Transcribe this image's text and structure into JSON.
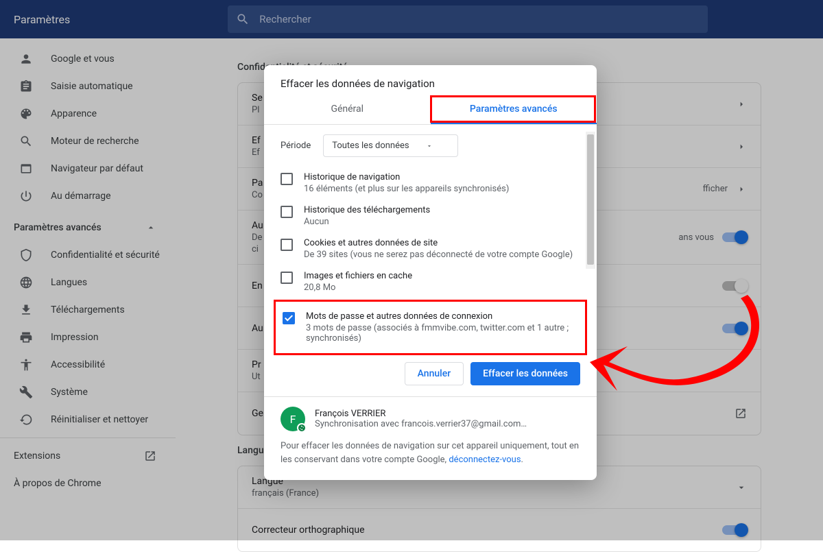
{
  "header": {
    "title": "Paramètres",
    "search_placeholder": "Rechercher"
  },
  "sidebar": {
    "items": [
      {
        "label": "Google et vous"
      },
      {
        "label": "Saisie automatique"
      },
      {
        "label": "Apparence"
      },
      {
        "label": "Moteur de recherche"
      },
      {
        "label": "Navigateur par défaut"
      },
      {
        "label": "Au démarrage"
      }
    ],
    "advanced_label": "Paramètres avancés",
    "advanced_items": [
      {
        "label": "Confidentialité et sécurité"
      },
      {
        "label": "Langues"
      },
      {
        "label": "Téléchargements"
      },
      {
        "label": "Impression"
      },
      {
        "label": "Accessibilité"
      },
      {
        "label": "Système"
      },
      {
        "label": "Réinitialiser et nettoyer"
      }
    ],
    "extensions": "Extensions",
    "about": "À propos de Chrome"
  },
  "main": {
    "section1_title": "Confidentialité et sécurité",
    "rows": [
      {
        "title": "Se",
        "sub": "Pl"
      },
      {
        "title": "Ef",
        "sub": "Ef"
      },
      {
        "title": "Pa",
        "sub": "Co",
        "right": "fficher"
      },
      {
        "title": "Au",
        "sub": "De",
        "right": "ans vous",
        "toggle": "on",
        "sub2": "ci"
      },
      {
        "title": "En",
        "sub": "",
        "toggle": "off"
      },
      {
        "title": "Au",
        "sub": "",
        "toggle": "on"
      },
      {
        "title": "Pr",
        "sub": "Ut"
      },
      {
        "title": "Ge",
        "sub": ""
      }
    ],
    "section2_title": "Langues",
    "lang_row": {
      "title": "Langue",
      "sub": "français (France)"
    },
    "spell_row": {
      "title": "Correcteur orthographique"
    }
  },
  "modal": {
    "title": "Effacer les données de navigation",
    "tab_general": "Général",
    "tab_advanced": "Paramètres avancés",
    "period_label": "Période",
    "period_value": "Toutes les données",
    "items": [
      {
        "t1": "Historique de navigation",
        "t2": "16 éléments (et plus sur les appareils synchronisés)",
        "checked": false
      },
      {
        "t1": "Historique des téléchargements",
        "t2": "Aucun",
        "checked": false
      },
      {
        "t1": "Cookies et autres données de site",
        "t2": "De 39 sites (vous ne serez pas déconnecté de votre compte Google)",
        "checked": false
      },
      {
        "t1": "Images et fichiers en cache",
        "t2": "20,8 Mo",
        "checked": false
      },
      {
        "t1": "Mots de passe et autres données de connexion",
        "t2": "3 mots de passe (associés à fmmvibe.com, twitter.com et 1 autre ; synchronisés)",
        "checked": true
      }
    ],
    "cancel": "Annuler",
    "confirm": "Effacer les données",
    "user_name": "François VERRIER",
    "user_sync": "Synchronisation avec francois.verrier37@gmail.com…",
    "user_initial": "F",
    "footer_text": "Pour effacer les données de navigation sur cet appareil uniquement, tout en les conservant dans votre compte Google, ",
    "footer_link": "déconnectez-vous",
    "footer_period": "."
  }
}
